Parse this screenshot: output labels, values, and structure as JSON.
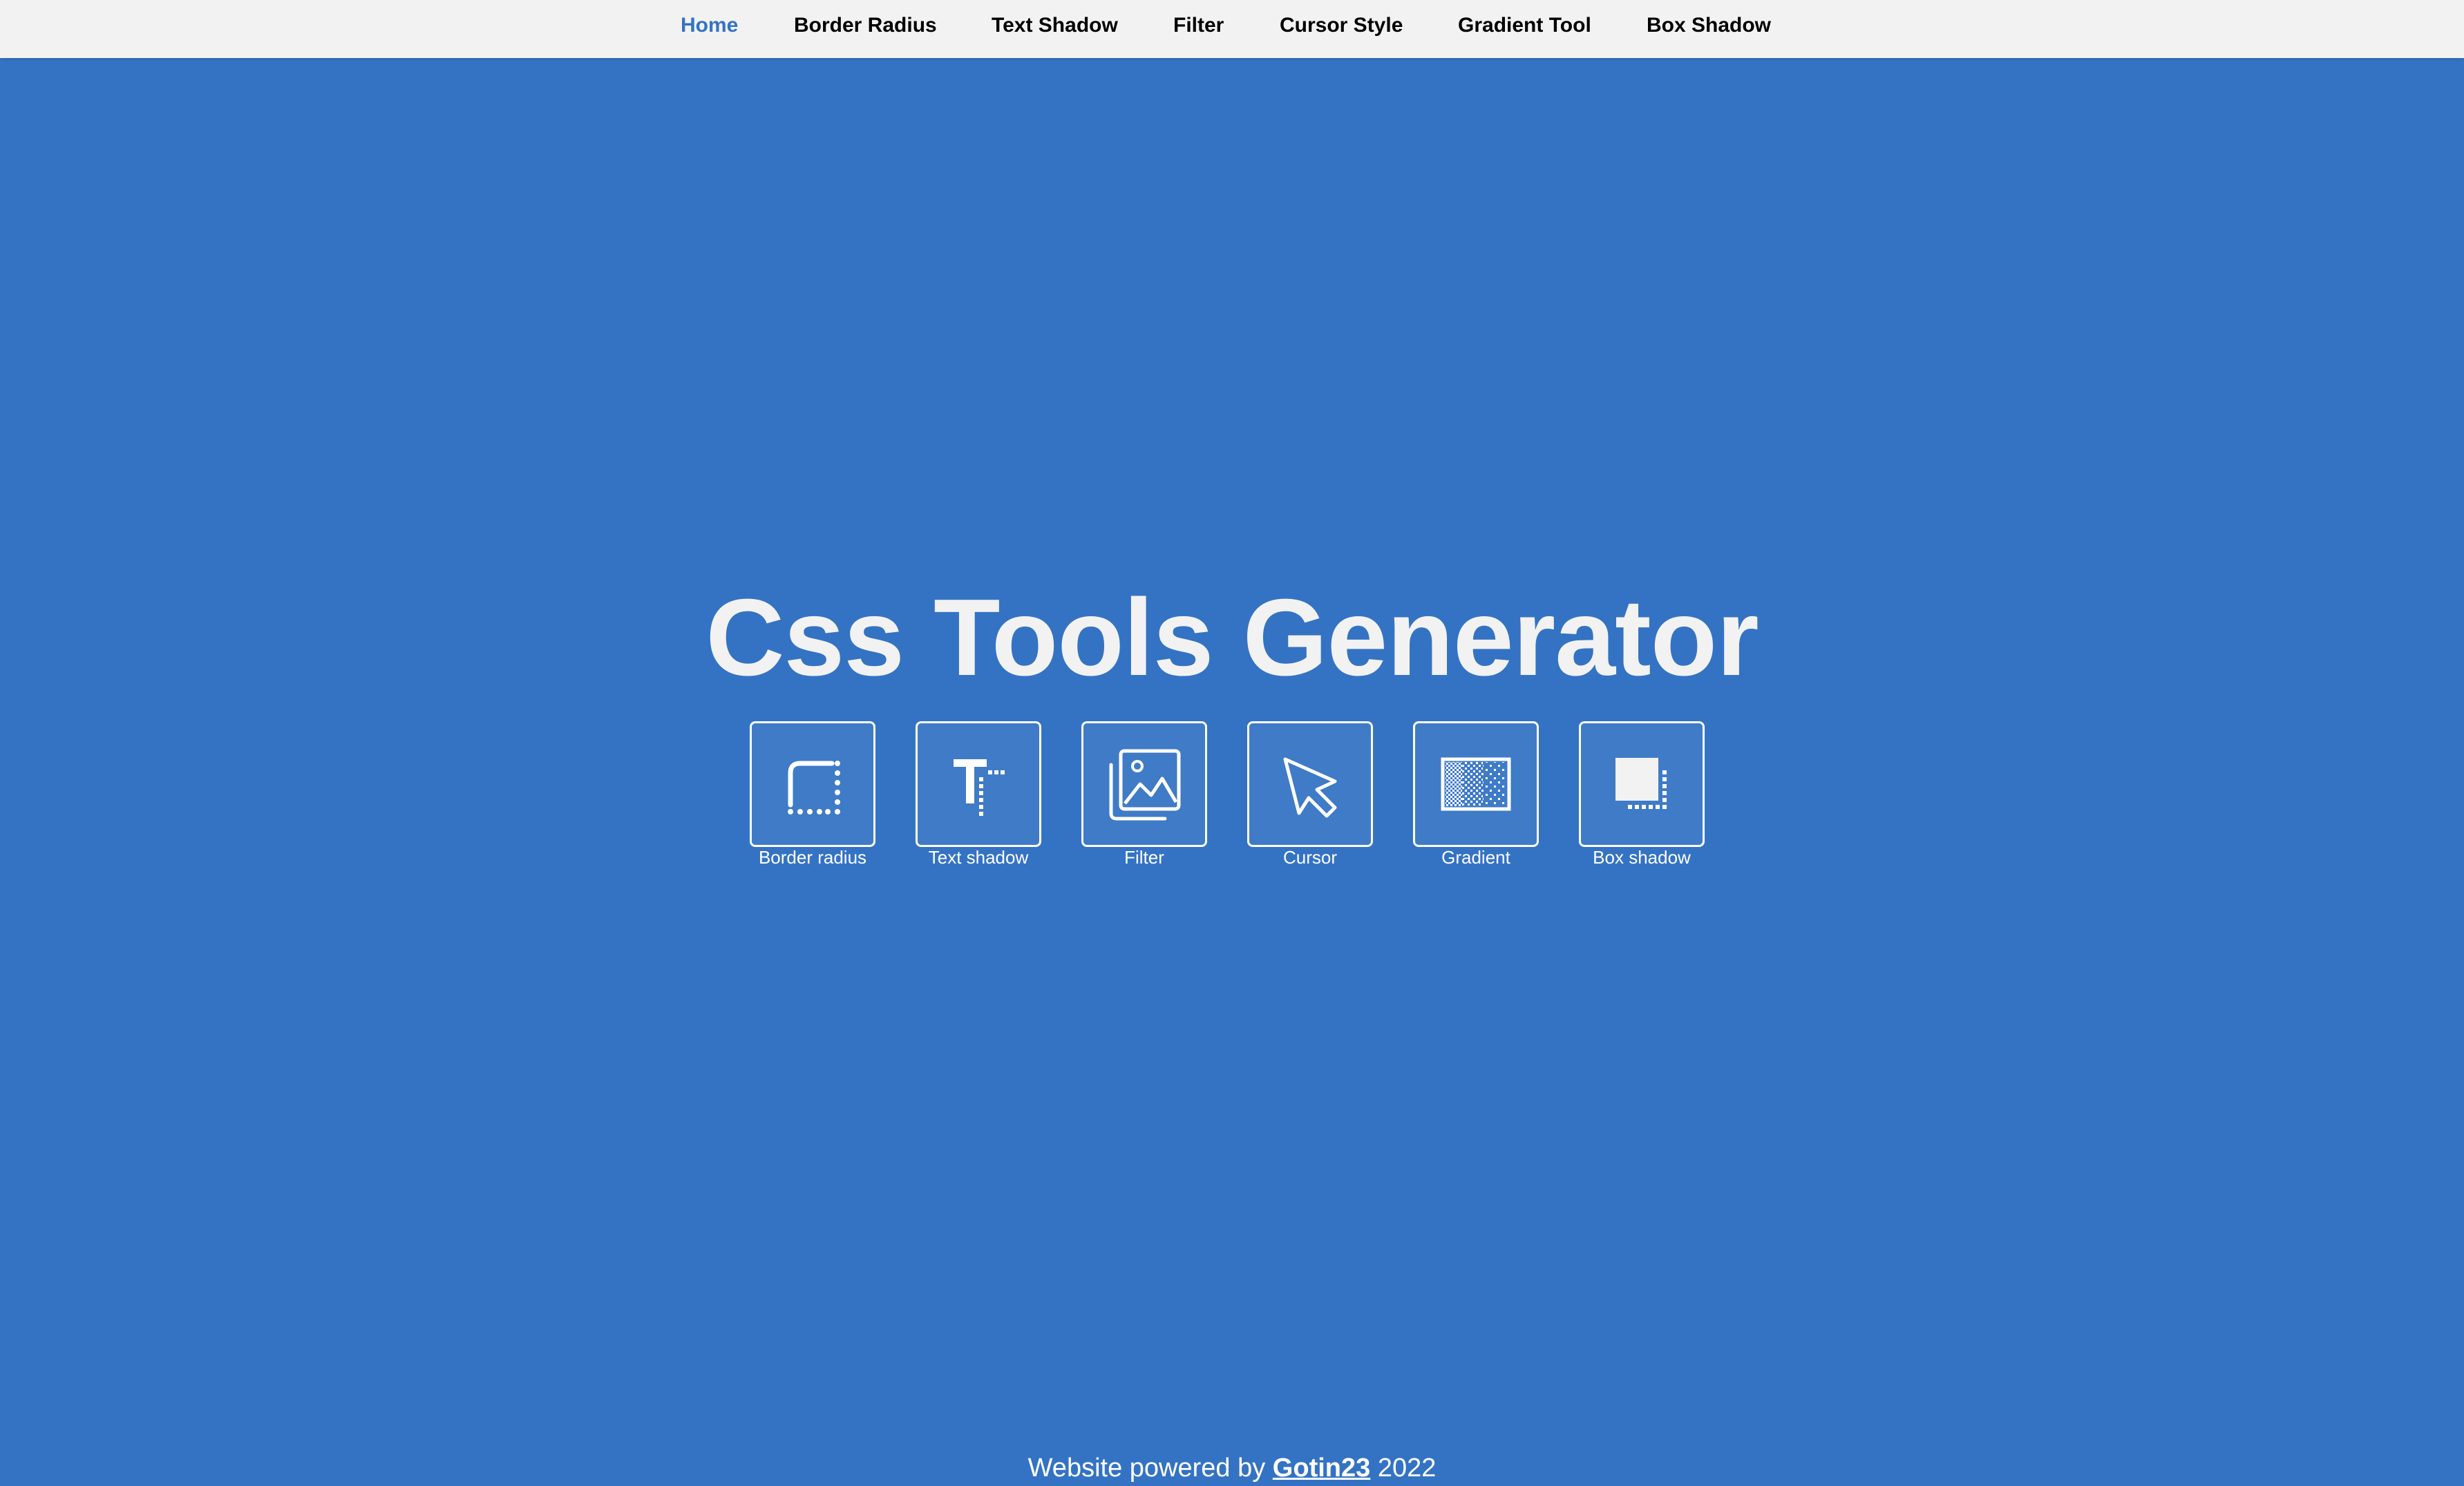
{
  "nav": {
    "items": [
      {
        "label": "Home",
        "active": true
      },
      {
        "label": "Border Radius",
        "active": false
      },
      {
        "label": "Text Shadow",
        "active": false
      },
      {
        "label": "Filter",
        "active": false
      },
      {
        "label": "Cursor Style",
        "active": false
      },
      {
        "label": "Gradient Tool",
        "active": false
      },
      {
        "label": "Box Shadow",
        "active": false
      }
    ]
  },
  "hero": {
    "title": "Css Tools Generator"
  },
  "tools": [
    {
      "label": "Border radius",
      "icon": "border-radius-icon"
    },
    {
      "label": "Text shadow",
      "icon": "text-shadow-icon"
    },
    {
      "label": "Filter",
      "icon": "image-filter-icon"
    },
    {
      "label": "Cursor",
      "icon": "cursor-arrow-icon"
    },
    {
      "label": "Gradient",
      "icon": "gradient-icon"
    },
    {
      "label": "Box shadow",
      "icon": "box-shadow-icon"
    }
  ],
  "footer": {
    "prefix": "Website powered by",
    "author": "Gotin23",
    "year": "2022"
  },
  "colors": {
    "background": "#3473c3",
    "navbar": "#f2f2f2",
    "nav_active": "#3473c3",
    "text_light": "#ffffff"
  }
}
